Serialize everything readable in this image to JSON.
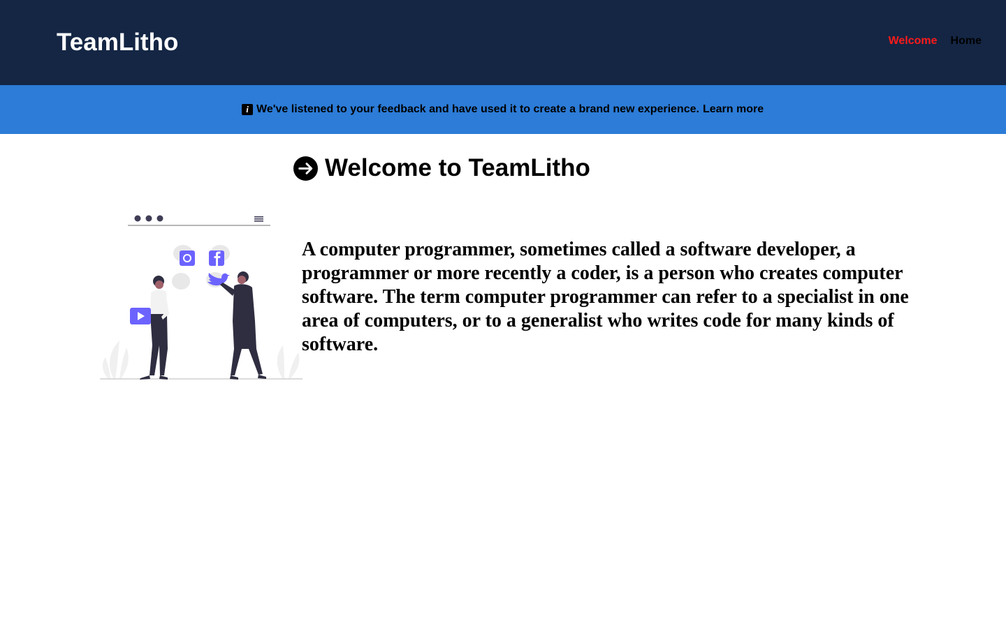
{
  "header": {
    "brand": "TeamLitho",
    "nav": [
      {
        "label": "Welcome",
        "active": true
      },
      {
        "label": "Home",
        "active": false
      }
    ],
    "background_color": "#142644",
    "active_color": "#ff1a1a"
  },
  "banner": {
    "icon": "info-icon",
    "message": "We've listened to your feedback and have used it to create a brand new experience.",
    "link": "Learn more",
    "background_color": "#2c7cd8"
  },
  "main": {
    "title_icon": "arrow-right-circle-icon",
    "title": "Welcome to TeamLitho",
    "illustration": "social-media-people-illustration",
    "description": "A computer programmer, sometimes called a software developer, a programmer or more recently a coder, is a person who creates computer software. The term computer programmer can refer to a specialist in one area of computers, or to a generalist who writes code for many kinds of software."
  }
}
